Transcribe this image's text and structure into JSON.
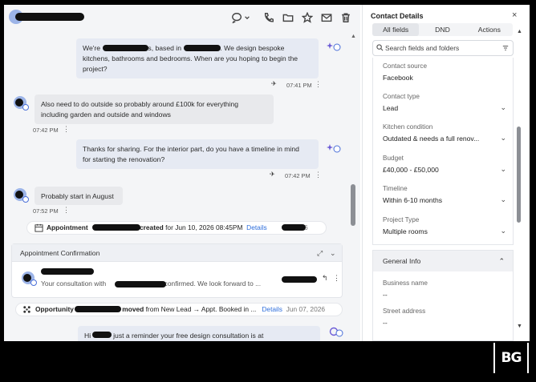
{
  "conversation": {
    "messages": [
      {
        "lines": [
          "We're ",
          "s, based in ",
          ". We design bespoke",
          "kitchens, bathrooms and bedrooms. When are you hoping to begin the",
          "project?"
        ],
        "time": "07:41 PM"
      },
      {
        "lines": [
          "Also need to do outside so probably around £100k for everything",
          "including garden and outside and windows"
        ],
        "time": "07:42 PM"
      },
      {
        "lines": [
          "Thanks for sharing. For the interior part, do you have a timeline in mind",
          "for starting the renovation?"
        ],
        "time": "07:42 PM"
      },
      {
        "lines": [
          "Probably start in August"
        ],
        "time": "07:52 PM"
      }
    ],
    "appointment_event": {
      "label": "Appointment",
      "created": "created",
      "rest": "for Jun 10, 2026 08:45PM",
      "link": "Details",
      "date_suffix": "2026"
    },
    "confirmation_card": {
      "title": "Appointment Confirmation",
      "text_start": "Your consultation with",
      "text_end": "s confirmed. We look forward to ..."
    },
    "opportunity_event": {
      "label": "Opportunity",
      "moved": "moved",
      "rest": "from New Lead → Appt. Booked in ...",
      "link": "Details",
      "date": "Jun 07, 2026"
    },
    "last_message": {
      "start": "Hi",
      "end": "just a reminder your free design consultation is at"
    }
  },
  "details": {
    "title": "Contact Details",
    "close": "×",
    "tabs": [
      "All fields",
      "DND",
      "Actions"
    ],
    "search_placeholder": "Search fields and folders",
    "fields": [
      {
        "label": "Contact source",
        "value": "Facebook"
      },
      {
        "label": "Contact type",
        "value": "Lead"
      },
      {
        "label": "Kitchen condition",
        "value": "Outdated & needs a full renov..."
      },
      {
        "label": "Budget",
        "value": "£40,000 - £50,000"
      },
      {
        "label": "Timeline",
        "value": "Within 6-10 months"
      },
      {
        "label": "Project Type",
        "value": "Multiple rooms"
      }
    ],
    "general_info": {
      "title": "General Info",
      "fields": [
        {
          "label": "Business name",
          "value": "--"
        },
        {
          "label": "Street address",
          "value": "--"
        }
      ]
    }
  },
  "brand": {
    "logo_text": "BG"
  },
  "colors": {
    "accent": "#2f6fdc",
    "outgoing_bubble": "#e6eaf3",
    "incoming_bubble": "#e8e9ec",
    "avatar": "#9cb4e8"
  }
}
